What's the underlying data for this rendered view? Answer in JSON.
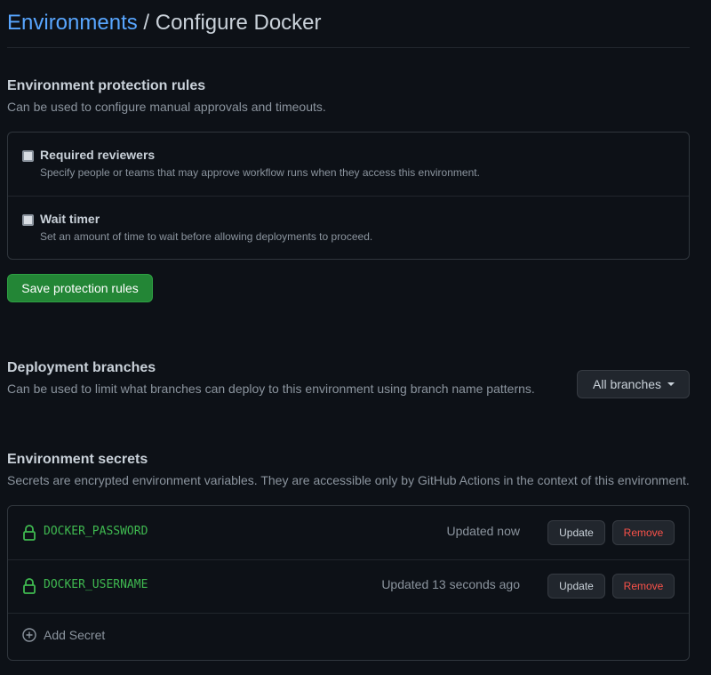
{
  "breadcrumb": {
    "parent": "Environments",
    "separator": " / ",
    "current": "Configure Docker"
  },
  "protection": {
    "title": "Environment protection rules",
    "description": "Can be used to configure manual approvals and timeouts.",
    "rules": [
      {
        "title": "Required reviewers",
        "description": "Specify people or teams that may approve workflow runs when they access this environment.",
        "checked": false
      },
      {
        "title": "Wait timer",
        "description": "Set an amount of time to wait before allowing deployments to proceed.",
        "checked": false
      }
    ],
    "save_label": "Save protection rules"
  },
  "branches": {
    "title": "Deployment branches",
    "description": "Can be used to limit what branches can deploy to this environment using branch name patterns.",
    "selected": "All branches"
  },
  "secrets": {
    "title": "Environment secrets",
    "description": "Secrets are encrypted environment variables. They are accessible only by GitHub Actions in the context of this environment.",
    "items": [
      {
        "name": "DOCKER_PASSWORD",
        "updated": "Updated now",
        "update_label": "Update",
        "remove_label": "Remove"
      },
      {
        "name": "DOCKER_USERNAME",
        "updated": "Updated 13 seconds ago",
        "update_label": "Update",
        "remove_label": "Remove"
      }
    ],
    "add_label": "Add Secret"
  },
  "icons": {
    "lock": "lock-icon",
    "plus": "plus-circle-icon",
    "caret": "triangle-down-icon"
  },
  "colors": {
    "background": "#0d1117",
    "link": "#58a6ff",
    "primary_button": "#238636",
    "secret_name": "#3fb950",
    "danger": "#f85149"
  }
}
